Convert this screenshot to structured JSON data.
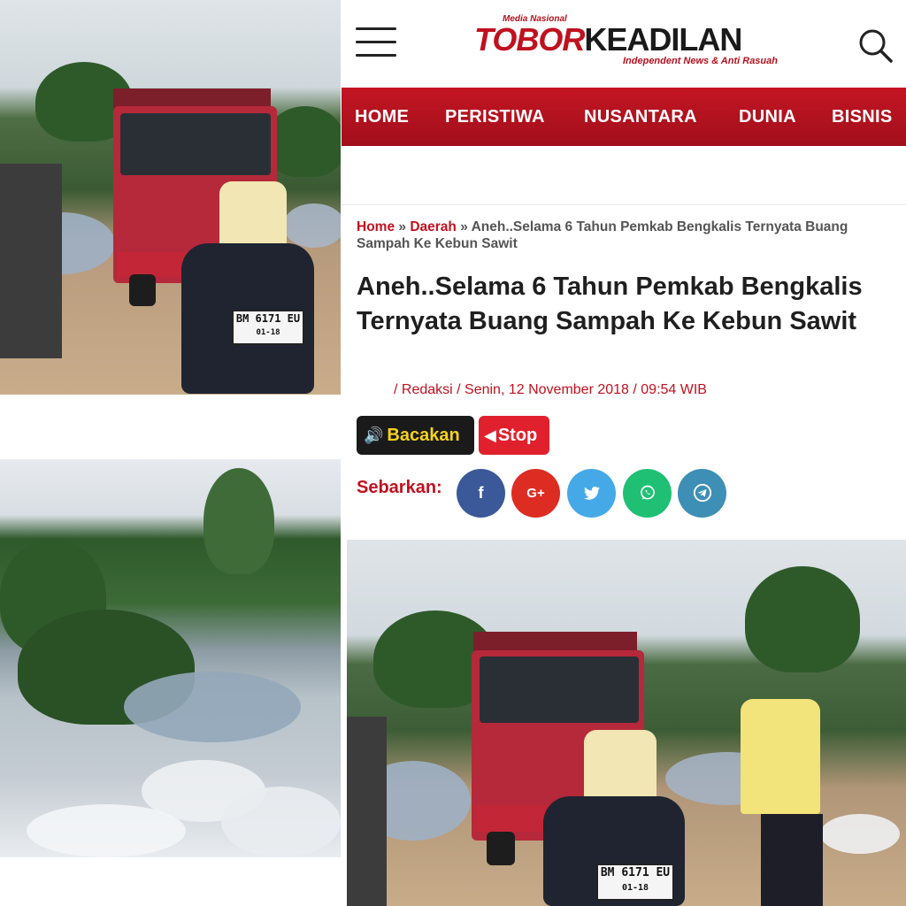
{
  "colors": {
    "brand_red": "#c0111f",
    "nav_red": "#b3121f",
    "tts_read_bg": "#1a1a1a",
    "tts_read_text": "#f7d21e",
    "tts_stop_bg": "#e0212d",
    "facebook": "#3b5998",
    "google_plus": "#dd2c22",
    "twitter": "#45a9e8",
    "whatsapp": "#1fc074",
    "telegram": "#3e8fb5"
  },
  "header": {
    "menu_icon": "hamburger-menu-icon",
    "search_icon": "search-icon",
    "logo": {
      "small_text": "Media Nasional",
      "part1": "TOBOR",
      "part2": "KEADILAN",
      "tagline": "Independent News & Anti Rasuah"
    }
  },
  "nav": {
    "items": [
      {
        "label": "HOME"
      },
      {
        "label": "PERISTIWA"
      },
      {
        "label": "NUSANTARA"
      },
      {
        "label": "DUNIA"
      },
      {
        "label": "BISNIS"
      }
    ]
  },
  "breadcrumb": {
    "home": "Home",
    "sep1": "»",
    "category": "Daerah",
    "sep2": "»",
    "current": "Aneh..Selama 6 Tahun Pemkab Bengkalis Ternyata Buang Sampah Ke Kebun Sawit"
  },
  "article": {
    "title": "Aneh..Selama 6 Tahun Pemkab Bengkalis Ternyata Buang Sampah Ke Kebun Sawit",
    "meta": "/ Redaksi / Senin, 12 November 2018 / 09:54 WIB"
  },
  "tts": {
    "read_label": "Bacakan",
    "read_icon": "speaker-icon",
    "stop_label": "Stop",
    "stop_icon": "speaker-mute-icon"
  },
  "share": {
    "label": "Sebarkan:",
    "buttons": [
      {
        "network": "facebook",
        "glyph": "f"
      },
      {
        "network": "google-plus",
        "glyph": "G+"
      },
      {
        "network": "twitter",
        "glyph": "twitter-bird-icon"
      },
      {
        "network": "whatsapp",
        "glyph": "whatsapp-icon"
      },
      {
        "network": "telegram",
        "glyph": "telegram-icon"
      }
    ]
  },
  "photos": {
    "plate_text": "BM 6171 EU",
    "plate_sub": "01-18"
  }
}
